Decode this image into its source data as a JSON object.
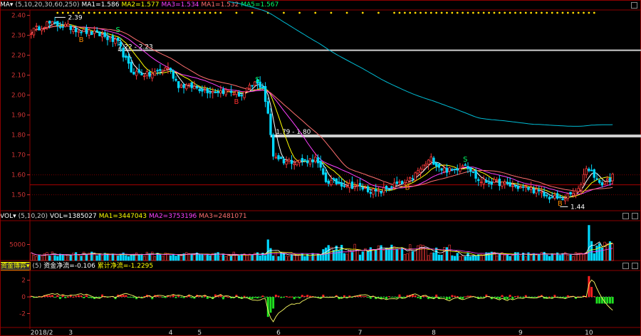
{
  "colors": {
    "bg": "#000000",
    "up": "#ff3b3b",
    "down": "#00d8ff",
    "ma5": "#ffffff",
    "ma10": "#ffff00",
    "ma20": "#ff40ff",
    "ma30": "#ff6f6f",
    "ma250": "#00bcd4",
    "grid": "#8b0000"
  },
  "header": {
    "main": {
      "label": "MA▾",
      "params": "(5,10,20,30,60,250)",
      "ma1": "MA1=1.586",
      "ma2": "MA2=1.577",
      "ma3": "MA3=1.534",
      "ma4": "MA1=1.532",
      "ma5": "MA5=1.567"
    },
    "vol": {
      "label": "VOL▾",
      "params": "(5,10,20)",
      "vol": "VOL=1385027",
      "ma1": "MA1=3447043",
      "ma2": "MA2=3753196",
      "ma3": "MA3=2481071"
    },
    "ind": {
      "label": "资金博弈▾",
      "params": "(5)",
      "v1": "资金净流=-0.106",
      "v2": "累计净流=-1.2295"
    }
  },
  "chart_data": [
    {
      "type": "candlestick",
      "price_axis": [
        "2.40",
        "2.30",
        "2.20",
        "2.10",
        "2.00",
        "1.90",
        "1.80",
        "1.70",
        "1.60",
        "1.50"
      ],
      "ylim": [
        1.42,
        2.42
      ],
      "annotations": {
        "high": {
          "text": "2.39",
          "value": 2.39
        },
        "low": {
          "text": "1.44",
          "value": 1.44
        },
        "range1": {
          "text": "2.22 - 2.23",
          "value": 2.225
        },
        "range2": {
          "text": "1.79 - 1.80",
          "value": 1.795
        }
      },
      "signals": [
        {
          "label": "B",
          "color": "#ff8c00",
          "idx": 19,
          "value": 2.28
        },
        {
          "label": "S",
          "color": "#00ff66",
          "idx": 33,
          "value": 2.33
        },
        {
          "label": "S",
          "color": "#00ff66",
          "idx": 86,
          "value": 2.08
        },
        {
          "label": "B",
          "color": "#ff3030",
          "idx": 78,
          "value": 1.97
        },
        {
          "label": "B",
          "color": "#ff8c00",
          "idx": 143,
          "value": 1.54
        },
        {
          "label": "S",
          "color": "#00ff66",
          "idx": 165,
          "value": 1.68
        },
        {
          "label": "B",
          "color": "#ff8c00",
          "idx": 201,
          "value": 1.46
        }
      ],
      "x_labels": [
        {
          "text": "2018/2",
          "idx": 4
        },
        {
          "text": "3",
          "idx": 15
        },
        {
          "text": "4",
          "idx": 53
        },
        {
          "text": "5",
          "idx": 64
        },
        {
          "text": "6",
          "idx": 94
        },
        {
          "text": "7",
          "idx": 125
        },
        {
          "text": "8",
          "idx": 153
        },
        {
          "text": "9",
          "idx": 186
        },
        {
          "text": "10",
          "idx": 212
        }
      ],
      "close_anchors": [
        [
          0,
          2.32
        ],
        [
          6,
          2.36
        ],
        [
          12,
          2.35
        ],
        [
          20,
          2.32
        ],
        [
          27,
          2.3
        ],
        [
          33,
          2.26
        ],
        [
          38,
          2.12
        ],
        [
          45,
          2.1
        ],
        [
          52,
          2.14
        ],
        [
          56,
          2.05
        ],
        [
          62,
          2.04
        ],
        [
          68,
          2.02
        ],
        [
          75,
          2.02
        ],
        [
          80,
          2.0
        ],
        [
          85,
          2.06
        ],
        [
          88,
          2.04
        ],
        [
          90,
          1.9
        ],
        [
          92,
          1.7
        ],
        [
          96,
          1.67
        ],
        [
          104,
          1.67
        ],
        [
          108,
          1.68
        ],
        [
          112,
          1.57
        ],
        [
          116,
          1.56
        ],
        [
          124,
          1.54
        ],
        [
          132,
          1.51
        ],
        [
          138,
          1.55
        ],
        [
          143,
          1.56
        ],
        [
          148,
          1.63
        ],
        [
          152,
          1.68
        ],
        [
          156,
          1.63
        ],
        [
          160,
          1.62
        ],
        [
          165,
          1.66
        ],
        [
          170,
          1.57
        ],
        [
          178,
          1.56
        ],
        [
          184,
          1.54
        ],
        [
          190,
          1.53
        ],
        [
          196,
          1.49
        ],
        [
          202,
          1.48
        ],
        [
          208,
          1.52
        ],
        [
          211,
          1.64
        ],
        [
          214,
          1.6
        ],
        [
          216,
          1.55
        ],
        [
          221,
          1.59
        ]
      ]
    },
    {
      "type": "bar",
      "name": "VOL",
      "y_axis": [
        "5000"
      ],
      "ylim": [
        0,
        12000
      ]
    },
    {
      "type": "line",
      "y_axis": [
        "2",
        "0",
        "-2"
      ],
      "ylim": [
        -3.5,
        3
      ]
    }
  ]
}
